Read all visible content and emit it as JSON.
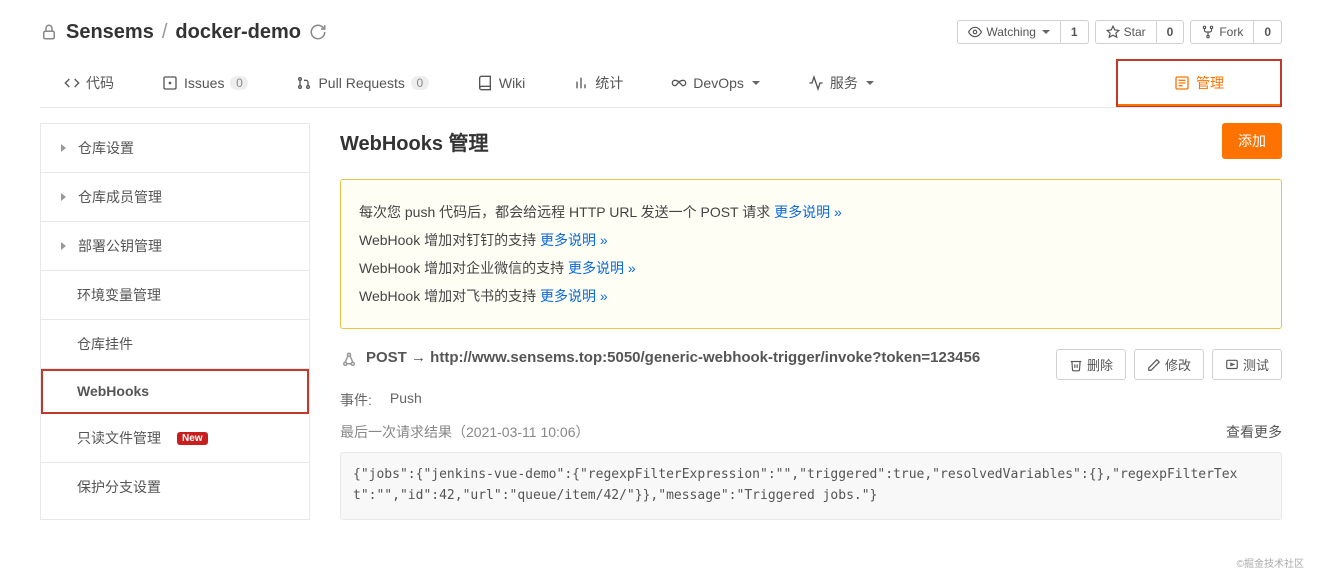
{
  "breadcrumb": {
    "owner": "Sensems",
    "repo": "docker-demo"
  },
  "header_stats": {
    "watch": {
      "label": "Watching",
      "count": "1"
    },
    "star": {
      "label": "Star",
      "count": "0"
    },
    "fork": {
      "label": "Fork",
      "count": "0"
    }
  },
  "nav": {
    "code": "代码",
    "issues": {
      "label": "Issues",
      "count": "0"
    },
    "pulls": {
      "label": "Pull Requests",
      "count": "0"
    },
    "wiki": "Wiki",
    "stats": "统计",
    "devops": "DevOps",
    "service": "服务",
    "admin": "管理"
  },
  "sidebar": {
    "repo_set": "仓库设置",
    "member": "仓库成员管理",
    "deploy": "部署公钥管理",
    "env": "环境变量管理",
    "plugin": "仓库挂件",
    "webhooks": "WebHooks",
    "readonly": {
      "label": "只读文件管理",
      "badge": "New"
    },
    "branch": "保护分支设置"
  },
  "page": {
    "title": "WebHooks 管理",
    "add_btn": "添加"
  },
  "notice": {
    "lines": [
      {
        "text": "每次您 push 代码后，都会给远程 HTTP URL 发送一个 POST 请求 ",
        "link": "更多说明 »"
      },
      {
        "text": "WebHook 增加对钉钉的支持 ",
        "link": "更多说明 »"
      },
      {
        "text": "WebHook 增加对企业微信的支持 ",
        "link": "更多说明 »"
      },
      {
        "text": "WebHook 增加对飞书的支持 ",
        "link": "更多说明 »"
      }
    ]
  },
  "webhook": {
    "url_display": "POST → http://www.sensems.top:5050/generic-webhook-trigger/invoke?token=123456",
    "delete": "删除",
    "edit": "修改",
    "test": "测试",
    "events_label": "事件:",
    "events": "Push",
    "last_label": "最后一次请求结果（2021-03-11 10:06）",
    "view_more": "查看更多",
    "payload": "{\"jobs\":{\"jenkins-vue-demo\":{\"regexpFilterExpression\":\"\",\"triggered\":true,\"resolvedVariables\":{},\"regexpFilterText\":\"\",\"id\":42,\"url\":\"queue/item/42/\"}},\"message\":\"Triggered jobs.\"}"
  },
  "watermark": "©掘金技术社区"
}
